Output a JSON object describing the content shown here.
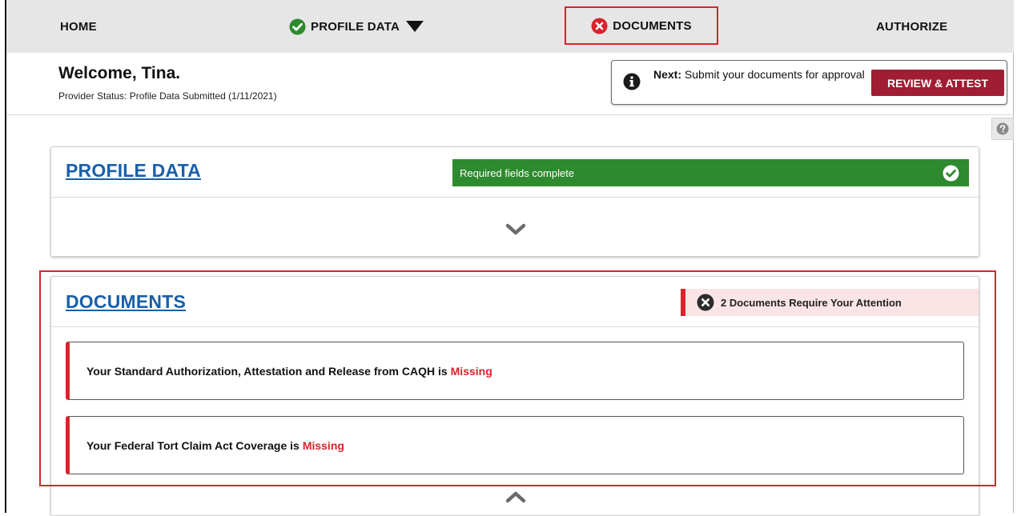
{
  "nav": {
    "home": "HOME",
    "profile_data": "PROFILE DATA",
    "documents": "DOCUMENTS",
    "authorize": "AUTHORIZE"
  },
  "header": {
    "welcome": "Welcome, Tina.",
    "status_label": "Provider Status:",
    "status_value": "Profile Data Submitted (1/11/2021)"
  },
  "next_step": {
    "label": "Next:",
    "text": "Submit your documents for approval",
    "button": "REVIEW & ATTEST"
  },
  "profile_card": {
    "title": "PROFILE DATA",
    "badge": "Required fields complete"
  },
  "documents_card": {
    "title": "DOCUMENTS",
    "badge": "2 Documents Require Your Attention",
    "items": [
      {
        "text": "Your Standard Authorization, Attestation and Release from CAQH is",
        "status": "Missing"
      },
      {
        "text": "Your Federal Tort Claim Act Coverage is",
        "status": "Missing"
      }
    ]
  },
  "colors": {
    "success": "#2d8a2e",
    "error": "#d9232d",
    "link": "#1a5fa8",
    "primary_button": "#a11d33"
  },
  "icons": {
    "profile_status": "check-circle-icon",
    "documents_status": "x-circle-icon",
    "info": "info-icon",
    "help": "question-circle-icon"
  }
}
